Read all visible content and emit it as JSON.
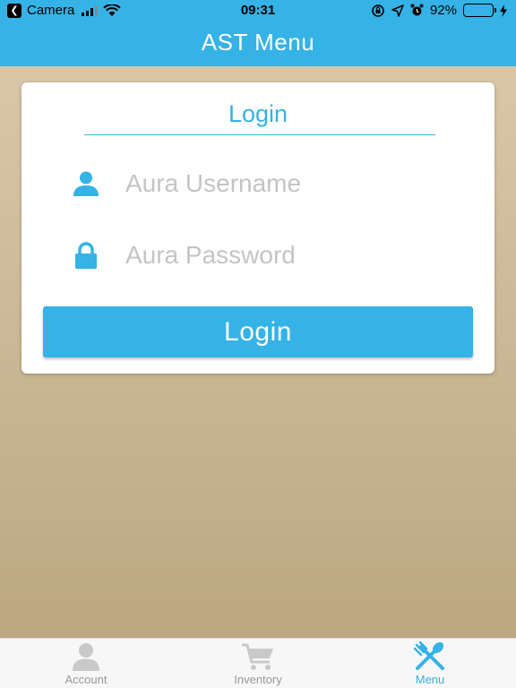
{
  "status_bar": {
    "back_app": "Camera",
    "time": "09:31",
    "battery": "92%",
    "battery_level": 0.92
  },
  "nav": {
    "title": "AST Menu"
  },
  "login_card": {
    "title": "Login",
    "username_placeholder": "Aura Username",
    "password_placeholder": "Aura Password",
    "login_button": "Login"
  },
  "tabs": [
    {
      "label": "Account",
      "icon": "person-icon",
      "active": false
    },
    {
      "label": "Inventory",
      "icon": "cart-icon",
      "active": false
    },
    {
      "label": "Menu",
      "icon": "utensils-icon",
      "active": true
    }
  ],
  "colors": {
    "accent": "#35b2e6",
    "background": "#c8b290",
    "inactive_tab": "#999999"
  }
}
